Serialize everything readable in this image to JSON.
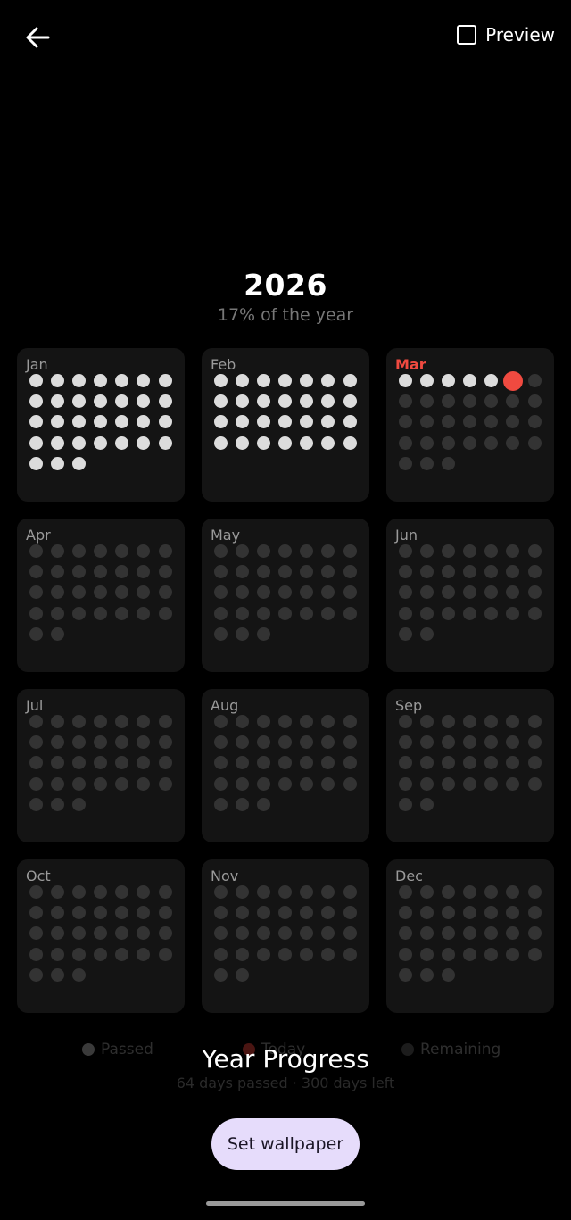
{
  "header": {
    "back_icon": "arrow-left-icon",
    "preview_label": "Preview",
    "preview_checked": false
  },
  "year": {
    "title": "2026",
    "subtitle": "17% of the year",
    "progress_percent": 17
  },
  "months": [
    {
      "name": "Jan",
      "days": 31,
      "passed": 31,
      "today": null
    },
    {
      "name": "Feb",
      "days": 28,
      "passed": 28,
      "today": null
    },
    {
      "name": "Mar",
      "days": 31,
      "passed": 5,
      "today": 6,
      "current": true
    },
    {
      "name": "Apr",
      "days": 30,
      "passed": 0,
      "today": null
    },
    {
      "name": "May",
      "days": 31,
      "passed": 0,
      "today": null
    },
    {
      "name": "Jun",
      "days": 30,
      "passed": 0,
      "today": null
    },
    {
      "name": "Jul",
      "days": 31,
      "passed": 0,
      "today": null
    },
    {
      "name": "Aug",
      "days": 31,
      "passed": 0,
      "today": null
    },
    {
      "name": "Sep",
      "days": 30,
      "passed": 0,
      "today": null
    },
    {
      "name": "Oct",
      "days": 31,
      "passed": 0,
      "today": null
    },
    {
      "name": "Nov",
      "days": 30,
      "passed": 0,
      "today": null
    },
    {
      "name": "Dec",
      "days": 31,
      "passed": 0,
      "today": null
    }
  ],
  "legend": {
    "passed": "Passed",
    "today": "Today",
    "remaining": "Remaining"
  },
  "stats": {
    "passed_text": "64 days passed",
    "left_text": "300 days left"
  },
  "app_title": "Year Progress",
  "set_wallpaper_label": "Set wallpaper",
  "colors": {
    "background": "#000000",
    "card": "#141414",
    "passed": "#dcdcdc",
    "today": "#f04a40",
    "remaining": "#333333",
    "button_bg": "#e6dcfb"
  }
}
